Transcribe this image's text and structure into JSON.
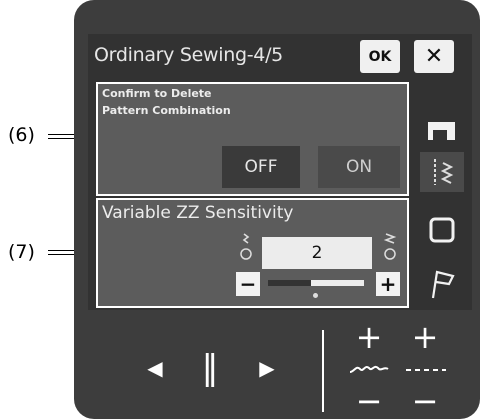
{
  "callouts": {
    "label_6": "(6)",
    "label_7": "(7)"
  },
  "header": {
    "title": "Ordinary Sewing-4/5",
    "ok_label": "OK",
    "close_label": "✕"
  },
  "settings": {
    "delete_confirm": {
      "line1": "Confirm to Delete",
      "line2": "Pattern Combination",
      "off_label": "OFF",
      "on_label": "ON",
      "selected": "ON"
    },
    "zz_sensitivity": {
      "title": "Variable ZZ Sensitivity",
      "value": "2",
      "minus_label": "−",
      "plus_label": "+",
      "slider_level": 0.45
    }
  },
  "sidebar": {
    "icons": [
      "sewing-machine-icon",
      "zigzag-stitch-icon",
      "square-frame-icon",
      "flag-icon"
    ]
  },
  "controls": {
    "left_label": "◀",
    "pause_label": "‖",
    "right_label": "▶",
    "width_plus": "+",
    "width_minus": "−",
    "length_plus": "+",
    "length_minus": "−",
    "width_symbol": "〰",
    "length_symbol": "----"
  }
}
